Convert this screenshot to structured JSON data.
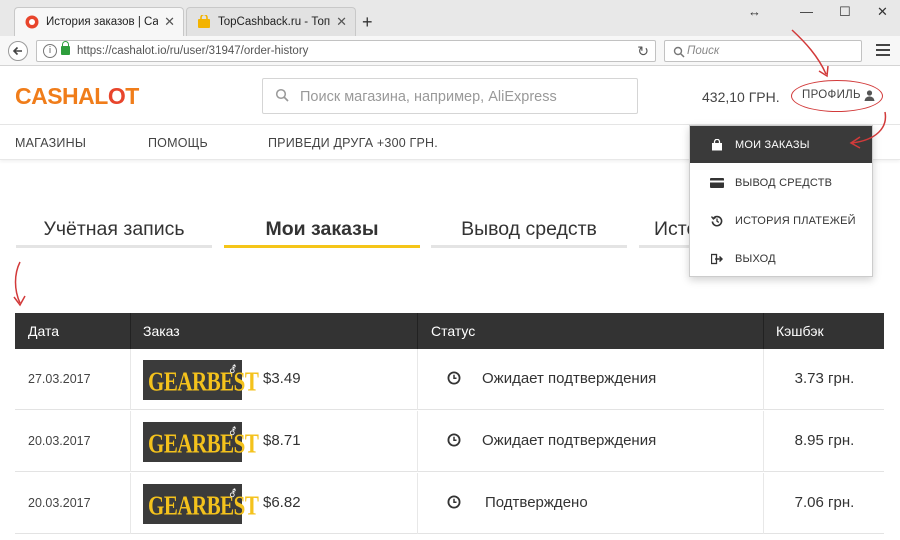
{
  "browser": {
    "tabs": [
      {
        "title": "История заказов | CashA…",
        "active": true
      },
      {
        "title": "TopCashback.ru - Топ лу…",
        "active": false
      }
    ],
    "new_tab": "+",
    "url": "https://cashalot.io/ru/user/31947/order-history",
    "search_placeholder": "Поиск",
    "window_controls": {
      "restore": "↔",
      "minimize": "—",
      "maximize": "☐",
      "close": "✕"
    }
  },
  "header": {
    "logo_part1": "CASHAL",
    "logo_part2": "O",
    "logo_part3": "T",
    "search_placeholder": "Поиск магазина, например, AliExpress",
    "balance": "432,10 ГРН.",
    "profile_label": "ПРОФИЛЬ"
  },
  "nav": {
    "items": [
      "МАГАЗИНЫ",
      "ПОМОЩЬ",
      "ПРИВЕДИ ДРУГА +300 ГРН."
    ]
  },
  "profile_tabs": [
    {
      "label": "Учётная запись",
      "active": false
    },
    {
      "label": "Мои заказы",
      "active": true
    },
    {
      "label": "Вывод средств",
      "active": false
    },
    {
      "label": "Исто",
      "active": false
    }
  ],
  "dropdown": {
    "items": [
      {
        "label": "МОИ ЗАКАЗЫ",
        "icon": "bag-icon",
        "selected": true
      },
      {
        "label": "ВЫВОД СРЕДСТВ",
        "icon": "card-icon",
        "selected": false
      },
      {
        "label": "ИСТОРИЯ ПЛАТЕЖЕЙ",
        "icon": "history-icon",
        "selected": false
      },
      {
        "label": "ВЫХОД",
        "icon": "logout-icon",
        "selected": false
      }
    ]
  },
  "orders_table": {
    "columns": [
      "Дата",
      "Заказ",
      "Статус",
      "Кэшбэк"
    ],
    "rows": [
      {
        "date": "27.03.2017",
        "store": "GEARBEST",
        "amount": "$3.49",
        "status": "Ожидает подтверждения",
        "cashback": "3.73 грн."
      },
      {
        "date": "20.03.2017",
        "store": "GEARBEST",
        "amount": "$8.71",
        "status": "Ожидает подтверждения",
        "cashback": "8.95 грн."
      },
      {
        "date": "20.03.2017",
        "store": "GEARBEST",
        "amount": "$6.82",
        "status": "Подтверждено",
        "cashback": "7.06 грн."
      }
    ]
  },
  "colors": {
    "accent_yellow": "#f5c518",
    "logo_orange": "#f07d1a",
    "logo_red": "#e8452c",
    "table_header": "#333333",
    "annotation_red": "#d23a3a"
  }
}
